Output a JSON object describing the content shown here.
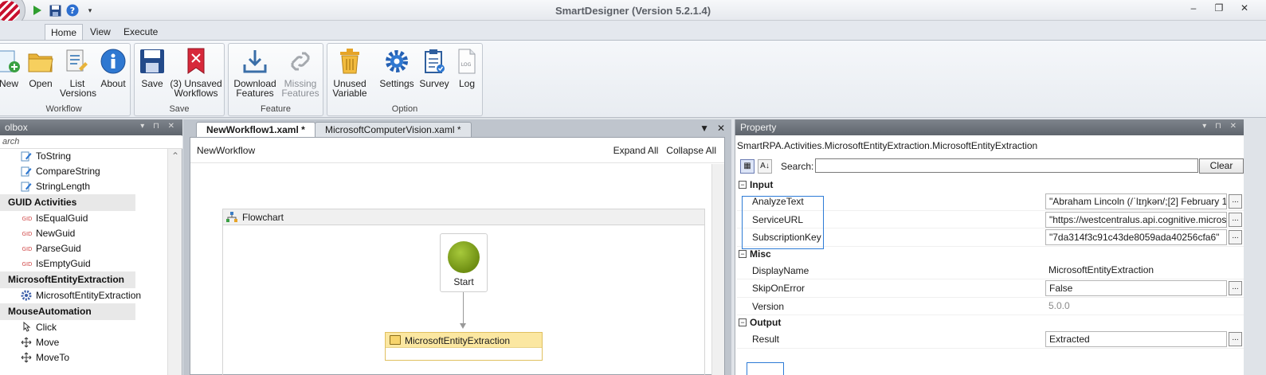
{
  "window": {
    "title": "SmartDesigner (Version 5.2.1.4)"
  },
  "ribbon": {
    "tabs": [
      "Home",
      "View",
      "Execute"
    ],
    "groups": {
      "workflow": {
        "label": "Workflow",
        "buttons": [
          "New",
          "Open",
          "List Versions",
          "About"
        ]
      },
      "save": {
        "label": "Save",
        "buttons": [
          "Save",
          "(3) Unsaved Workflows"
        ]
      },
      "feature": {
        "label": "Feature",
        "buttons": [
          "Download Features",
          "Missing Features"
        ]
      },
      "option": {
        "label": "Option",
        "buttons": [
          "Unused Variable",
          "Settings",
          "Survey",
          "Log"
        ]
      }
    }
  },
  "toolbox": {
    "title": "olbox",
    "search_placeholder": "arch",
    "items": [
      {
        "kind": "item",
        "label": "ToString",
        "icon": "pencil-icon"
      },
      {
        "kind": "item",
        "label": "CompareString",
        "icon": "pencil-icon"
      },
      {
        "kind": "item",
        "label": "StringLength",
        "icon": "pencil-icon"
      },
      {
        "kind": "category",
        "label": "GUID Activities"
      },
      {
        "kind": "item",
        "label": "IsEqualGuid",
        "icon": "guid-icon"
      },
      {
        "kind": "item",
        "label": "NewGuid",
        "icon": "guid-icon"
      },
      {
        "kind": "item",
        "label": "ParseGuid",
        "icon": "guid-icon"
      },
      {
        "kind": "item",
        "label": "IsEmptyGuid",
        "icon": "guid-icon"
      },
      {
        "kind": "category",
        "label": "MicrosoftEntityExtraction"
      },
      {
        "kind": "item",
        "label": "MicrosoftEntityExtraction",
        "icon": "gear-icon"
      },
      {
        "kind": "category",
        "label": "MouseAutomation"
      },
      {
        "kind": "item",
        "label": "Click",
        "icon": "mouse-click-icon"
      },
      {
        "kind": "item",
        "label": "Move",
        "icon": "move-icon"
      },
      {
        "kind": "item",
        "label": "MoveTo",
        "icon": "move-icon"
      }
    ]
  },
  "designer": {
    "tabs": [
      "NewWorkflow1.xaml *",
      "MicrosoftComputerVision.xaml *"
    ],
    "breadcrumb": "NewWorkflow",
    "expand_all": "Expand All",
    "collapse_all": "Collapse All",
    "flowchart_label": "Flowchart",
    "start_label": "Start",
    "activity_label": "MicrosoftEntityExtraction"
  },
  "property": {
    "title": "Property",
    "type_name": "SmartRPA.Activities.MicrosoftEntityExtraction.MicrosoftEntityExtraction",
    "search_label": "Search:",
    "search_value": "",
    "clear_label": "Clear",
    "categories": [
      {
        "name": "Input",
        "rows": [
          {
            "name": "AnalyzeText",
            "value": "\"Abraham Lincoln (/ˈlɪŋkən/;[2] February 1",
            "boxed": true,
            "ellipsis": true
          },
          {
            "name": "ServiceURL",
            "value": "\"https://westcentralus.api.cognitive.micros",
            "boxed": true,
            "ellipsis": true
          },
          {
            "name": "SubscriptionKey",
            "value": "\"7da314f3c91c43de8059ada40256cfa6\"",
            "boxed": true,
            "ellipsis": true
          }
        ]
      },
      {
        "name": "Misc",
        "rows": [
          {
            "name": "DisplayName",
            "value": "MicrosoftEntityExtraction",
            "boxed": false,
            "ellipsis": false
          },
          {
            "name": "SkipOnError",
            "value": "False",
            "boxed": true,
            "ellipsis": true
          },
          {
            "name": "Version",
            "value": "5.0.0",
            "boxed": false,
            "ellipsis": false,
            "muted": true
          }
        ]
      },
      {
        "name": "Output",
        "rows": [
          {
            "name": "Result",
            "value": "Extracted",
            "boxed": true,
            "ellipsis": true
          }
        ]
      }
    ]
  },
  "colors": {
    "accent": "#2d7bd6",
    "activity_header": "#fbe7a1",
    "start_node": "#8aad24",
    "panel_header": "#6b7179"
  }
}
